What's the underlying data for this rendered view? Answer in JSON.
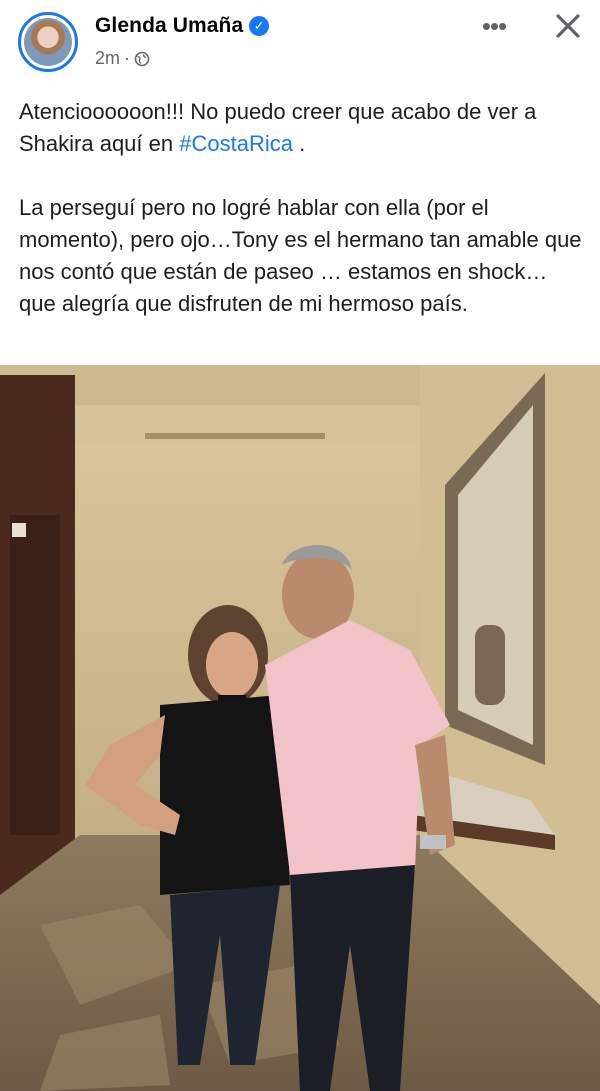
{
  "post": {
    "author": "Glenda Umaña",
    "time": "2m",
    "separator": "·",
    "text_line_1_start": "Atencioooooon!!! No puedo creer que acabo de ver a Shakira aquí en ",
    "hashtag": "#CostaRica",
    "text_line_1_end": " .",
    "paragraph_2": "La perseguí pero no logré hablar con ella (por el momento), pero ojo…Tony es el hermano tan amable que nos contó que están de paseo … estamos en shock… que alegría que disfruten de mi hermoso país."
  },
  "icons": {
    "verified": "verified-badge-icon",
    "privacy": "globe-icon",
    "more": "more-options-icon",
    "close": "close-icon"
  },
  "colors": {
    "accent": "#1877f2",
    "secondary_text": "#65676b"
  }
}
